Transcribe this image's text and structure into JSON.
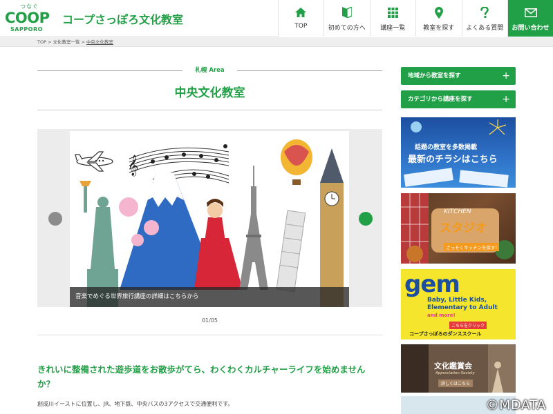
{
  "header": {
    "logo_kana": "つなぐ",
    "logo_main": "COOP",
    "logo_sub": "SAPPORO",
    "site_title": "コープさっぽろ文化教室"
  },
  "nav": {
    "items": [
      {
        "label": "TOP",
        "icon": "home-icon"
      },
      {
        "label": "初めての方へ",
        "icon": "beginner-leaf-icon"
      },
      {
        "label": "講座一覧",
        "icon": "grid-icon"
      },
      {
        "label": "教室を探す",
        "icon": "map-pin-icon"
      },
      {
        "label": "よくある質問",
        "icon": "question-icon"
      },
      {
        "label": "お問い合わせ",
        "icon": "mail-icon"
      }
    ]
  },
  "breadcrumb": {
    "items": [
      "TOP",
      "文化教室一覧",
      "中央文化教室"
    ],
    "separator": ">"
  },
  "main": {
    "area_label": "札幌 Area",
    "title": "中央文化教室",
    "slider": {
      "caption": "音楽でめぐる世界旅行講座の詳細はこちらから",
      "counter": "01/05"
    },
    "lead": "きれいに整備された遊歩道をお散歩がてら、わくわくカルチャーライフを始めませんか？",
    "body": "創成川イーストに位置し、JR、地下鉄、中央バスの3アクセスで交通便利です。"
  },
  "sidebar": {
    "buttons": [
      {
        "label": "地域から教室を探す",
        "icon": "+"
      },
      {
        "label": "カテゴリから講座を探す",
        "icon": "+"
      }
    ],
    "banners": {
      "flyer_sub": "話題の教室を多数掲載",
      "flyer_main": "最新のチラシはこちら",
      "kitchen_en": "KITCHEN",
      "kitchen_main": "スタジオ",
      "kitchen_cta": "さっそくキッチンを探す!",
      "gem_logo": "gem",
      "gem_tagline": "Baby, Little Kids, Elementary to Adult",
      "gem_more": "and more!",
      "gem_cta": "こちらをクリック",
      "gem_school": "コープさっぽろのダンススクール",
      "culture_main": "文化鑑賞会",
      "culture_en": "Appreciation Society",
      "culture_cta": "詳しくはこちら"
    }
  },
  "watermark": "©MDATA",
  "colors": {
    "brand_green": "#22a047",
    "breadcrumb_bg": "#efefef"
  }
}
